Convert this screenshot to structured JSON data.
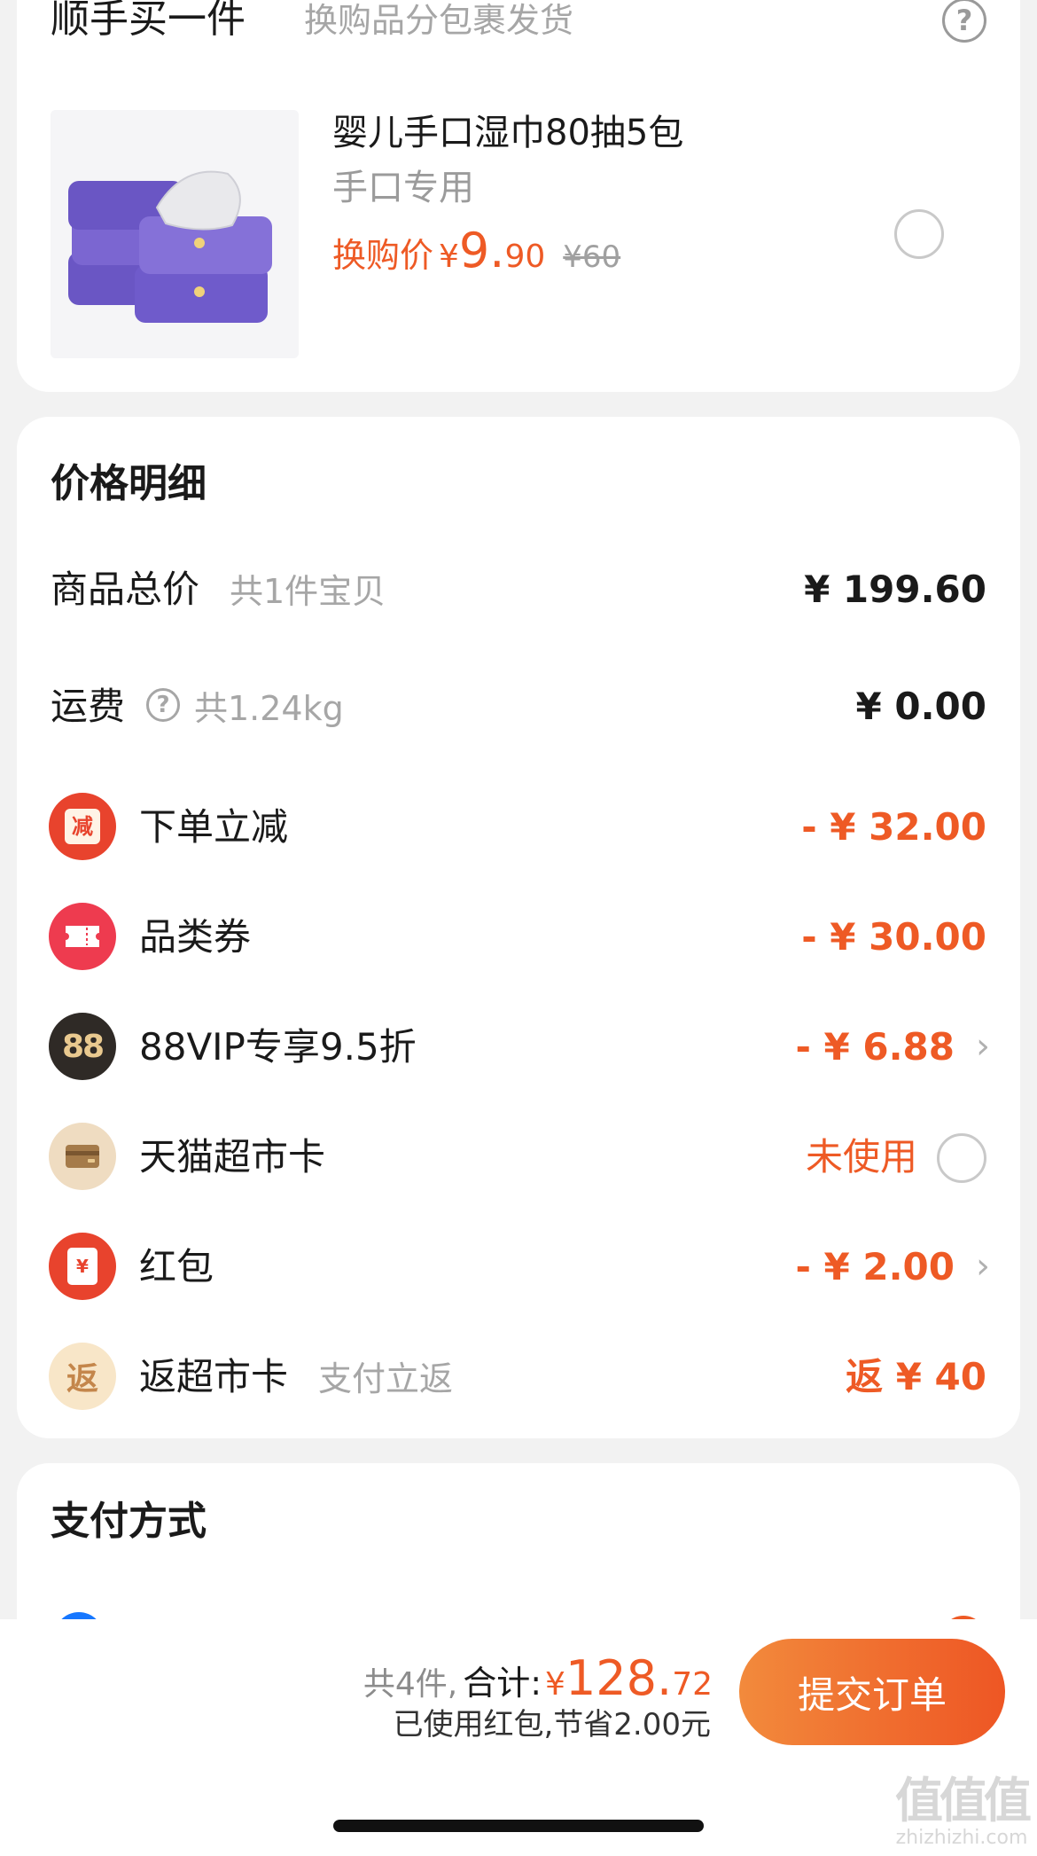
{
  "upsell": {
    "title": "顺手买一件",
    "subtitle": "换购品分包裹发货",
    "help_icon": "question-circle",
    "product": {
      "name": "婴儿手口湿巾80抽5包",
      "tag": "手口专用",
      "price_label": "换购价",
      "currency": "¥",
      "price_int": "9.",
      "price_dec": "90",
      "original_price": "¥60",
      "selected": false
    }
  },
  "price_detail": {
    "title": "价格明细",
    "goods_total": {
      "label": "商品总价",
      "note": "共1件宝贝",
      "value": "¥ 199.60"
    },
    "shipping": {
      "label": "运费",
      "note": "共1.24kg",
      "value": "¥ 0.00"
    },
    "rows": [
      {
        "icon": "discount-badge",
        "icon_text": "减",
        "label": "下单立减",
        "value": "- ¥ 32.00",
        "arrow": false
      },
      {
        "icon": "coupon-ticket",
        "label": "品类券",
        "value": "- ¥ 30.00",
        "arrow": false
      },
      {
        "icon": "88vip-badge",
        "icon_text": "88",
        "label": "88VIP专享9.5折",
        "value": "- ¥ 6.88",
        "arrow": true
      },
      {
        "icon": "supermarket-card",
        "label": "天猫超市卡",
        "value": "未使用",
        "radio": true
      },
      {
        "icon": "red-packet",
        "icon_text": "¥",
        "label": "红包",
        "value": "- ¥ 2.00",
        "arrow": true
      },
      {
        "icon": "return-badge",
        "icon_text": "返",
        "label": "返超市卡",
        "note": "支付立返",
        "value": "返 ¥ 40"
      }
    ]
  },
  "payment": {
    "title": "支付方式"
  },
  "bottom_bar": {
    "count": "共4件,",
    "total_label": "合计:",
    "currency": "¥",
    "total_int": "128.",
    "total_dec": "72",
    "saved": "已使用红包,节省2.00元",
    "submit_label": "提交订单"
  },
  "watermark": {
    "main": "值值值",
    "sub": "zhizhizhi.com"
  },
  "colors": {
    "accent": "#ee5a25",
    "submit_start": "#f28a3c",
    "submit_end": "#ee5624"
  }
}
